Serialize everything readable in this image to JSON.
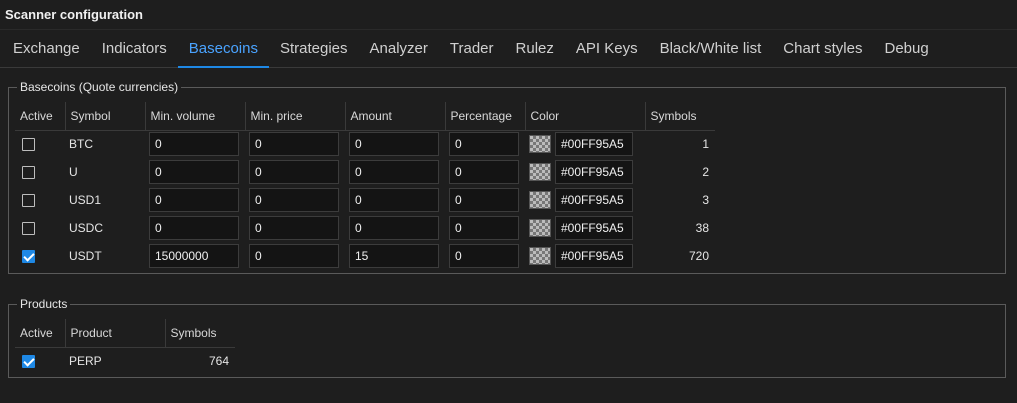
{
  "window": {
    "title": "Scanner configuration"
  },
  "tabs": [
    {
      "label": "Exchange"
    },
    {
      "label": "Indicators"
    },
    {
      "label": "Basecoins",
      "active": true
    },
    {
      "label": "Strategies"
    },
    {
      "label": "Analyzer"
    },
    {
      "label": "Trader"
    },
    {
      "label": "Rulez"
    },
    {
      "label": "API Keys"
    },
    {
      "label": "Black/White list"
    },
    {
      "label": "Chart styles"
    },
    {
      "label": "Debug"
    }
  ],
  "basecoins": {
    "title": "Basecoins (Quote currencies)",
    "headers": {
      "active": "Active",
      "symbol": "Symbol",
      "min_volume": "Min. volume",
      "min_price": "Min. price",
      "amount": "Amount",
      "percentage": "Percentage",
      "color": "Color",
      "symbols": "Symbols"
    },
    "rows": [
      {
        "active": false,
        "symbol": "BTC",
        "min_volume": "0",
        "min_price": "0",
        "amount": "0",
        "percentage": "0",
        "color": "#00FF95A5",
        "symbols": "1"
      },
      {
        "active": false,
        "symbol": "U",
        "min_volume": "0",
        "min_price": "0",
        "amount": "0",
        "percentage": "0",
        "color": "#00FF95A5",
        "symbols": "2"
      },
      {
        "active": false,
        "symbol": "USD1",
        "min_volume": "0",
        "min_price": "0",
        "amount": "0",
        "percentage": "0",
        "color": "#00FF95A5",
        "symbols": "3"
      },
      {
        "active": false,
        "symbol": "USDC",
        "min_volume": "0",
        "min_price": "0",
        "amount": "0",
        "percentage": "0",
        "color": "#00FF95A5",
        "symbols": "38"
      },
      {
        "active": true,
        "symbol": "USDT",
        "min_volume": "15000000",
        "min_price": "0",
        "amount": "15",
        "percentage": "0",
        "color": "#00FF95A5",
        "symbols": "720"
      }
    ]
  },
  "products": {
    "title": "Products",
    "headers": {
      "active": "Active",
      "product": "Product",
      "symbols": "Symbols"
    },
    "rows": [
      {
        "active": true,
        "product": "PERP",
        "symbols": "764"
      }
    ]
  },
  "colors": {
    "accent": "#1e88e5",
    "active_tab_text": "#4aa3ff",
    "background": "#1e1e1e"
  }
}
